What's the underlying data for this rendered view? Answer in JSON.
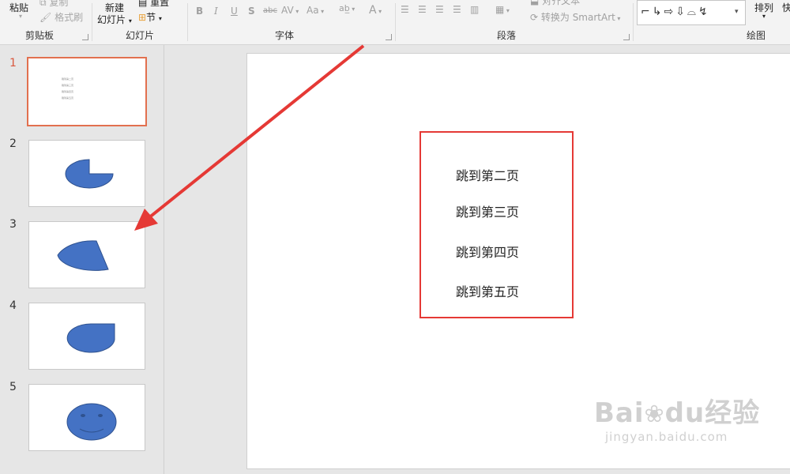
{
  "ribbon": {
    "clipboard": {
      "paste": "粘贴",
      "copy": "复制",
      "format_painter": "格式刷",
      "label": "剪贴板"
    },
    "slides": {
      "new_slide_line1": "新建",
      "new_slide_line2": "幻灯片",
      "reset": "重置",
      "section": "节",
      "label": "幻灯片"
    },
    "font": {
      "bold": "B",
      "italic": "I",
      "underline": "U",
      "shadow": "S",
      "strike": "abc",
      "spacing": "AV",
      "case": "Aa",
      "color": "A",
      "label": "字体"
    },
    "paragraph": {
      "align_text": "对齐文本",
      "convert_smartart": "转换为 SmartArt",
      "label": "段落"
    },
    "drawing": {
      "arrange": "排列",
      "quick_styles": "快",
      "label": "绘图"
    }
  },
  "thumbnails": [
    {
      "number": "1",
      "active": true,
      "lines": [
        "跳到第二页",
        "跳到第三页",
        "跳到第四页",
        "跳到第五页"
      ]
    },
    {
      "number": "2",
      "active": false,
      "shape": "pie"
    },
    {
      "number": "3",
      "active": false,
      "shape": "sector"
    },
    {
      "number": "4",
      "active": false,
      "shape": "teardrop"
    },
    {
      "number": "5",
      "active": false,
      "shape": "smiley"
    }
  ],
  "slide": {
    "links": [
      "跳到第二页",
      "跳到第三页",
      "跳到第四页",
      "跳到第五页"
    ]
  },
  "colors": {
    "shape_fill": "#4472c4",
    "highlight": "#e53935",
    "active_thumb": "#e2704f"
  },
  "watermark": {
    "brand": "Bai",
    "brand2": "du",
    "brand_cn": "经验",
    "url": "jingyan.baidu.com"
  }
}
